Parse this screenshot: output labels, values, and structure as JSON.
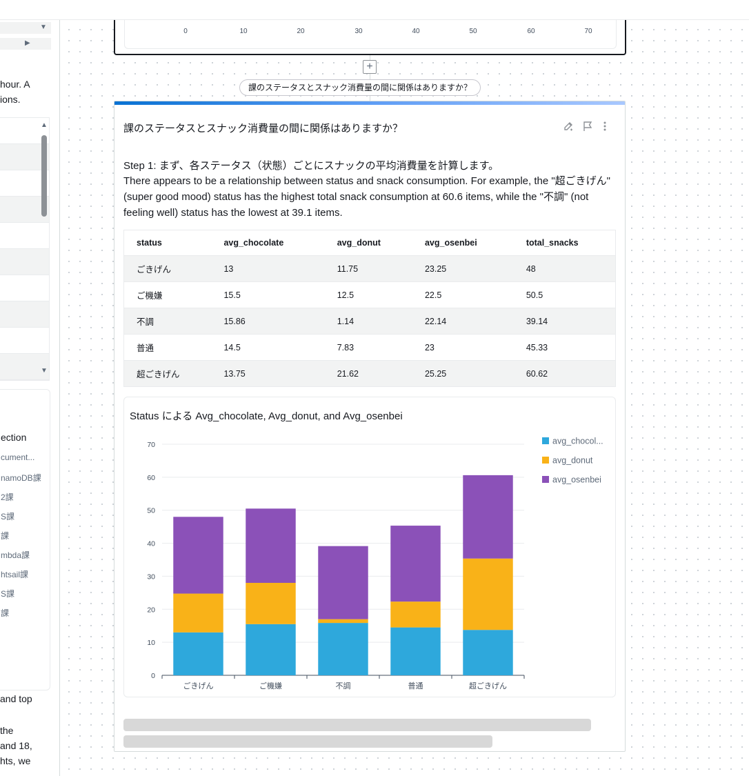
{
  "left_panel": {
    "text_lines_top": [
      "hour. A",
      "ions."
    ],
    "section_heading": "ection",
    "list_items": [
      "cument...",
      "namoDB課",
      "2課",
      "S課",
      "課",
      "mbda課",
      "htsail課",
      "S課",
      "課"
    ],
    "text_lines_bottom": [
      "and top",
      "the",
      "and 18,",
      "hts, we"
    ]
  },
  "top_chart": {
    "ticks": [
      "0",
      "10",
      "20",
      "30",
      "40",
      "50",
      "60",
      "70"
    ]
  },
  "question_pill": "課のステータスとスナック消費量の間に関係はありますか？",
  "answer": {
    "title": "課のステータスとスナック消費量の間に関係はありますか？",
    "step": "Step 1: まず、各ステータス（状態）ごとにスナックの平均消費量を計算します。",
    "summary": "There appears to be a relationship between status and snack consumption. For example, the \"超ごきげん\" (super good mood) status has the highest total snack consumption at 60.6 items, while the \"不調\" (not feeling well) status has the lowest at 39.1 items.",
    "actions": [
      "edit-icon",
      "flag-icon",
      "more-icon"
    ]
  },
  "table": {
    "columns": [
      "status",
      "avg_chocolate",
      "avg_donut",
      "avg_osenbei",
      "total_snacks"
    ],
    "rows": [
      [
        "ごきげん",
        "13",
        "11.75",
        "23.25",
        "48"
      ],
      [
        "ご機嫌",
        "15.5",
        "12.5",
        "22.5",
        "50.5"
      ],
      [
        "不調",
        "15.86",
        "1.14",
        "22.14",
        "39.14"
      ],
      [
        "普通",
        "14.5",
        "7.83",
        "23",
        "45.33"
      ],
      [
        "超ごきげん",
        "13.75",
        "21.62",
        "25.25",
        "60.62"
      ]
    ]
  },
  "chart_data": {
    "type": "bar",
    "stacked": true,
    "title": "Status による Avg_chocolate, Avg_donut, and Avg_osenbei",
    "categories": [
      "ごきげん",
      "ご機嫌",
      "不調",
      "普通",
      "超ごきげん"
    ],
    "series": [
      {
        "name": "avg_chocolate",
        "legend_label": "avg_chocol...",
        "color": "#2ea8dc",
        "values": [
          13,
          15.5,
          15.86,
          14.5,
          13.75
        ]
      },
      {
        "name": "avg_donut",
        "legend_label": "avg_donut",
        "color": "#f9b218",
        "values": [
          11.75,
          12.5,
          1.14,
          7.83,
          21.62
        ]
      },
      {
        "name": "avg_osenbei",
        "legend_label": "avg_osenbei",
        "color": "#8b51b8",
        "values": [
          23.25,
          22.5,
          22.14,
          23,
          25.25
        ]
      }
    ],
    "yticks": [
      "0",
      "10",
      "20",
      "30",
      "40",
      "50",
      "60",
      "70"
    ],
    "ylim": [
      0,
      70
    ],
    "grid": true,
    "legend_position": "right"
  },
  "colors": {
    "accent": "#0972d3",
    "gridline": "#e9ebed",
    "skeleton": "#d8d8d8"
  }
}
